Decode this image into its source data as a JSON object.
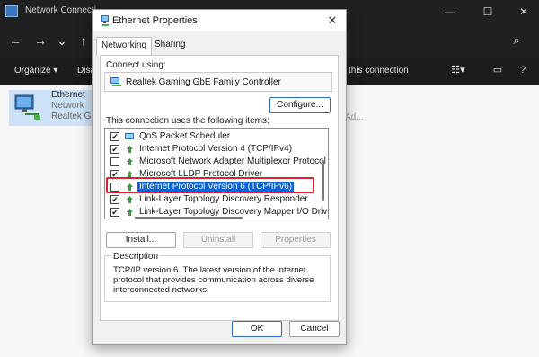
{
  "background": {
    "window_title": "Network Connecti",
    "window_controls": [
      "—",
      "☐",
      "✕"
    ],
    "nav_buttons": [
      "←",
      "→",
      "⌄",
      "↑"
    ],
    "search_icon": "search-icon",
    "cmdbar": {
      "organize": "Organize ▾",
      "disable_partial": "Disa",
      "connection_partial": "this connection",
      "view_icon": "view-list-icon",
      "pane_icon": "details-pane-icon",
      "more_icon": "more-icon"
    },
    "connection": {
      "name": "Ethernet",
      "network": "Network",
      "adapter_partial": "Realtek Ga"
    },
    "extra_partial": "Ad..."
  },
  "dialog": {
    "title": "Ethernet Properties",
    "close": "✕",
    "tabs": [
      {
        "label": "Networking",
        "active": true
      },
      {
        "label": "Sharing",
        "active": false
      }
    ],
    "connect_using_label": "Connect using:",
    "adapter_name": "Realtek Gaming GbE Family Controller",
    "configure_label": "Configure...",
    "items_label": "This connection uses the following items:",
    "items": [
      {
        "label": "QoS Packet Scheduler",
        "checked": true,
        "selected": false
      },
      {
        "label": "Internet Protocol Version 4 (TCP/IPv4)",
        "checked": true,
        "selected": false
      },
      {
        "label": "Microsoft Network Adapter Multiplexor Protocol",
        "checked": false,
        "selected": false
      },
      {
        "label": "Microsoft LLDP Protocol Driver",
        "checked": true,
        "selected": false
      },
      {
        "label": "Internet Protocol Version 6 (TCP/IPv6)",
        "checked": false,
        "selected": true
      },
      {
        "label": "Link-Layer Topology Discovery Responder",
        "checked": true,
        "selected": false
      },
      {
        "label": "Link-Layer Topology Discovery Mapper I/O Driver",
        "checked": true,
        "selected": false
      }
    ],
    "install_label": "Install...",
    "uninstall_label": "Uninstall",
    "properties_label": "Properties",
    "description_label": "Description",
    "description_text": "TCP/IP version 6. The latest version of the internet protocol that provides communication across diverse interconnected networks.",
    "ok_label": "OK",
    "cancel_label": "Cancel",
    "highlight_color": "#d9252f",
    "selection_color": "#0a64d8"
  }
}
